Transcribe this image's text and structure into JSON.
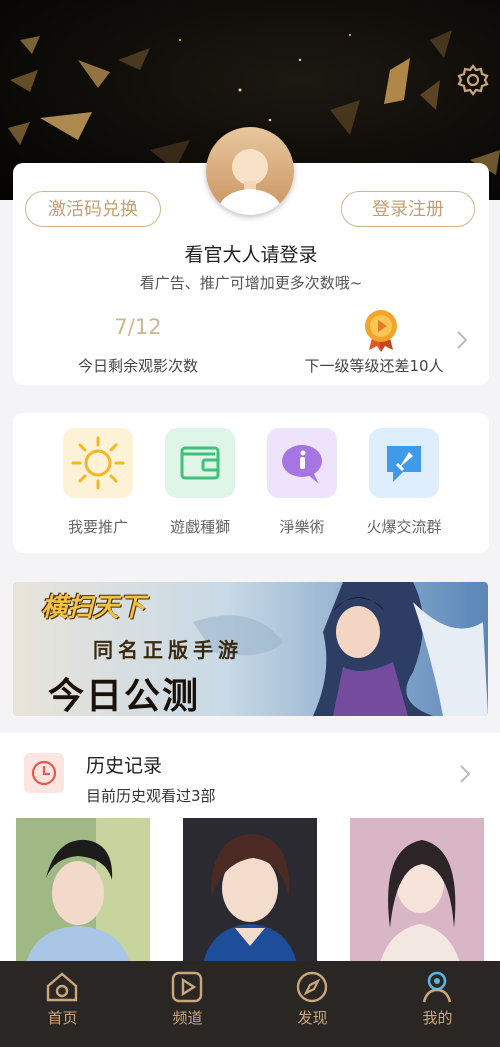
{
  "header": {
    "settings_icon": "gear-icon"
  },
  "profile": {
    "redeem_label": "激活码兑换",
    "login_register_label": "登录注册",
    "title": "看官大人请登录",
    "subtitle": "看广告、推广可增加更多次数哦~",
    "views_count": "7/12",
    "views_label": "今日剩余观影次数",
    "level_label": "下一级等级还差10人"
  },
  "shortcuts": [
    {
      "label": "我要推广",
      "icon": "sun-icon",
      "color": "#f5b627"
    },
    {
      "label": "遊戲種獅",
      "icon": "wallet-icon",
      "color": "#3cc27a"
    },
    {
      "label": "淨樂術",
      "icon": "info-chat-icon",
      "color": "#9a6ad9"
    },
    {
      "label": "火爆交流群",
      "icon": "rocket-chat-icon",
      "color": "#3f9ae8"
    }
  ],
  "banner": {
    "logo_text": "横扫天下",
    "sub_text": "同名正版手游",
    "title_text": "今日公测"
  },
  "history": {
    "title": "历史记录",
    "subtitle": "目前历史观看过3部"
  },
  "tabs": [
    {
      "label": "首页",
      "icon": "home-icon"
    },
    {
      "label": "频道",
      "icon": "play-icon"
    },
    {
      "label": "发现",
      "icon": "compass-icon"
    },
    {
      "label": "我的",
      "icon": "user-icon"
    }
  ],
  "colors": {
    "accent_gold": "#c9a77c",
    "tabbar_bg": "#2a2623"
  }
}
